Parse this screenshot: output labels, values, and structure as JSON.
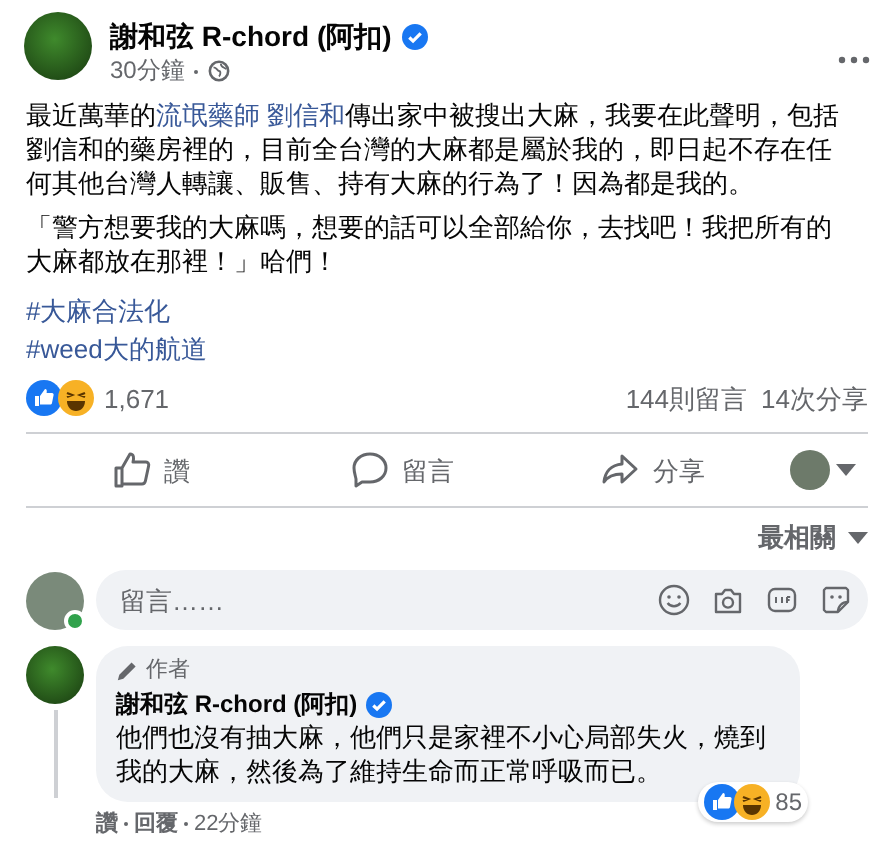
{
  "post": {
    "author": "謝和弦 R-chord (阿扣)",
    "verified": true,
    "time": "30分鐘",
    "paragraphs": [
      [
        {
          "text": "最近萬華的"
        },
        {
          "text": "流氓藥師 劉信和",
          "kind": "link"
        },
        {
          "text": "傳出家中被搜出大麻，我要在此聲明，包括劉信和的藥房裡的，目前全台灣的大麻都是屬於我的，即日起不存在任何其他台灣人轉讓、販售、持有大麻的行為了！因為都是我的。"
        }
      ],
      [
        {
          "text": "「警方想要我的大麻嗎，想要的話可以全部給你，去找吧！我把所有的大麻都放在那裡！」哈們！"
        }
      ]
    ],
    "hashtags": [
      "#大麻合法化",
      "#weed大的航道"
    ],
    "reaction_count": "1,671",
    "comments_count": "144則留言",
    "shares_count": "14次分享"
  },
  "actions": [
    {
      "kind": "like",
      "label": "讚"
    },
    {
      "kind": "comment",
      "label": "留言"
    },
    {
      "kind": "share",
      "label": "分享"
    }
  ],
  "sort": "最相關",
  "comment_input": {
    "placeholder": "留言……",
    "online": true
  },
  "comments": [
    {
      "badge": "作者",
      "author": "謝和弦 R-chord (阿扣)",
      "verified": true,
      "text": "他們也沒有抽大麻，他們只是家裡不小心局部失火，燒到我的大麻，然後為了維持生命而正常呼吸而已。",
      "reaction_count": "85",
      "actions": [
        "讚",
        "回覆",
        "22分鐘"
      ]
    }
  ]
}
